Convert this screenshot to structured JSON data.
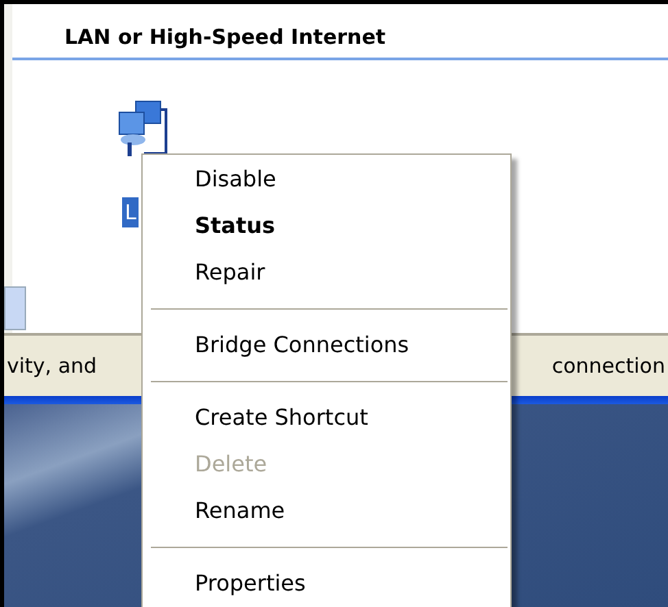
{
  "section": {
    "title": "LAN or High-Speed Internet"
  },
  "connection": {
    "label": "L",
    "selected": true
  },
  "status_bar": {
    "texts": [
      "vity, and",
      "connection"
    ]
  },
  "context_menu": {
    "items": [
      {
        "kind": "item",
        "label": "Disable",
        "default": false,
        "disabled": false
      },
      {
        "kind": "item",
        "label": "Status",
        "default": true,
        "disabled": false
      },
      {
        "kind": "item",
        "label": "Repair",
        "default": false,
        "disabled": false
      },
      {
        "kind": "separator"
      },
      {
        "kind": "item",
        "label": "Bridge Connections",
        "default": false,
        "disabled": false
      },
      {
        "kind": "separator"
      },
      {
        "kind": "item",
        "label": "Create Shortcut",
        "default": false,
        "disabled": false
      },
      {
        "kind": "item",
        "label": "Delete",
        "default": false,
        "disabled": true
      },
      {
        "kind": "item",
        "label": "Rename",
        "default": false,
        "disabled": false
      },
      {
        "kind": "separator"
      },
      {
        "kind": "item",
        "label": "Properties",
        "default": false,
        "disabled": false
      }
    ]
  }
}
